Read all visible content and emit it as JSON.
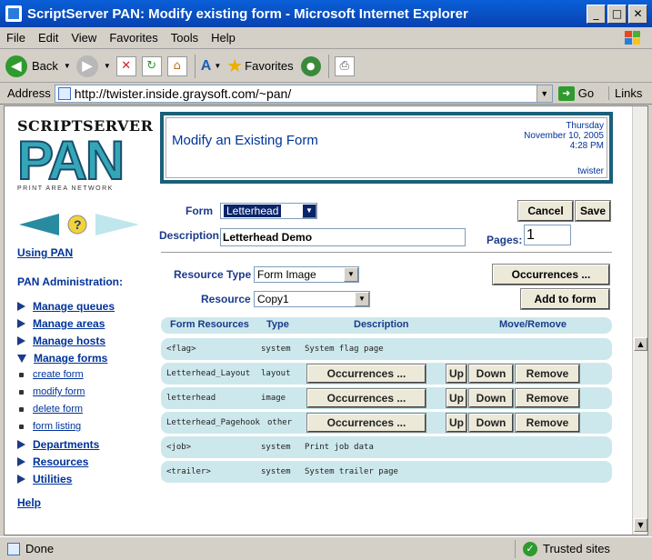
{
  "window": {
    "title": "ScriptServer PAN: Modify existing form - Microsoft Internet Explorer",
    "min": "_",
    "max": "□",
    "close": "✕"
  },
  "menu": [
    "File",
    "Edit",
    "View",
    "Favorites",
    "Tools",
    "Help"
  ],
  "toolbar": {
    "back": "Back",
    "favorites": "Favorites"
  },
  "address": {
    "label": "Address",
    "url": "http://twister.inside.graysoft.com/~pan/",
    "go": "Go",
    "links": "Links"
  },
  "brand": {
    "top": "SCRIPTSERVER",
    "big": "PAN",
    "sub": "PRINT AREA NETWORK"
  },
  "sidebar": {
    "using_pan": "Using PAN",
    "admin_heading": "PAN Administration:",
    "items": [
      "Manage queues",
      "Manage areas",
      "Manage hosts",
      "Manage forms"
    ],
    "subitems": [
      "create form",
      "modify form",
      "delete form",
      "form listing"
    ],
    "items2": [
      "Departments",
      "Resources",
      "Utilities"
    ],
    "help": "Help"
  },
  "header": {
    "title": "Modify an Existing Form",
    "day": "Thursday",
    "date": "November 10, 2005",
    "time": "4:28 PM",
    "host": "twister"
  },
  "form": {
    "form_label": "Form",
    "form_value": "Letterhead",
    "description_label": "Description",
    "description_value": "Letterhead Demo",
    "pages_label": "Pages:",
    "pages_value": "1",
    "cancel": "Cancel",
    "save": "Save",
    "resource_type_label": "Resource Type",
    "resource_type_value": "Form Image",
    "resource_label": "Resource",
    "resource_value": "Copy1",
    "occurrences": "Occurrences ...",
    "add_to_form": "Add to form"
  },
  "table": {
    "headers": [
      "Form Resources",
      "Type",
      "Description",
      "Move/Remove"
    ],
    "rows": [
      {
        "name": "<flag>",
        "type": "system",
        "desc": "System flag page"
      },
      {
        "name": "Letterhead_Layout",
        "type": "layout",
        "btn": "Occurrences ..."
      },
      {
        "name": "letterhead",
        "type": "image",
        "btn": "Occurrences ..."
      },
      {
        "name": "Letterhead_Pagehook",
        "type": "other",
        "btn": "Occurrences ..."
      },
      {
        "name": "<job>",
        "type": "system",
        "desc": "Print job data"
      },
      {
        "name": "<trailer>",
        "type": "system",
        "desc": "System trailer page"
      }
    ],
    "up": "Up",
    "down": "Down",
    "remove": "Remove"
  },
  "status": {
    "left": "Done",
    "zone": "Trusted sites"
  }
}
